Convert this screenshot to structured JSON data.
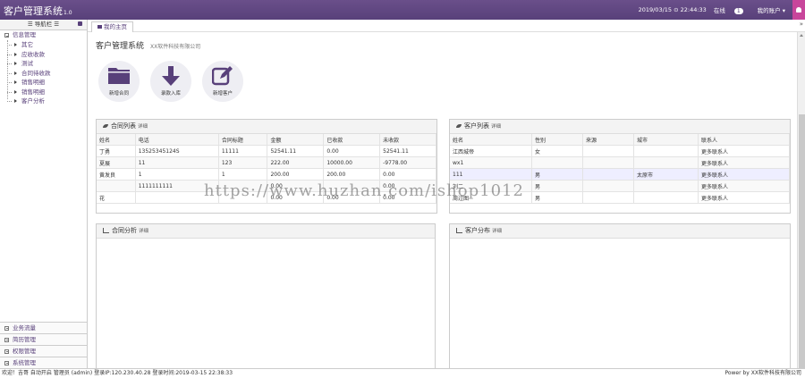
{
  "header": {
    "brand": "客户管理系统",
    "version": "1.0",
    "datetime": "2019/03/15 ⊙ 22:44:33",
    "online_label": "在线",
    "online_count": "1",
    "user_menu": "我的账户 ▾"
  },
  "sidebar": {
    "title": "☰ 导航栏 ☰",
    "group_main": "信息管理",
    "items": [
      "其它",
      "应收收款",
      "测试",
      "合同待收款",
      "销售明细",
      "销售明细",
      "客户分析"
    ],
    "bottom_groups": [
      "业务流量",
      "简历管理",
      "权限管理",
      "系统管理"
    ]
  },
  "tabs": {
    "home": "我的主页",
    "chevron": "»"
  },
  "page": {
    "title": "客户管理系统",
    "subtitle": "XX软件科技有限公司",
    "quick_buttons": [
      {
        "label": "新增合同",
        "icon": "folder-icon"
      },
      {
        "label": "录款入库",
        "icon": "arrow-down-icon"
      },
      {
        "label": "新增客户",
        "icon": "edit-icon"
      }
    ]
  },
  "contract_panel": {
    "title": "合同列表",
    "more": "详细",
    "columns": [
      "姓名",
      "电话",
      "合同标题",
      "金额",
      "已收款",
      "未收款"
    ],
    "rows": [
      [
        "丁勇",
        "13525345124S",
        "11111",
        "52541.11",
        "0.00",
        "52541.11"
      ],
      [
        "夏展",
        "11",
        "123",
        "222.00",
        "10000.00",
        "-9778.00"
      ],
      [
        "黄发良",
        "1",
        "1",
        "200.00",
        "200.00",
        "0.00"
      ],
      [
        "",
        "1111111111",
        "",
        "0.00",
        "",
        "0.00"
      ],
      [
        "花",
        "",
        "",
        "0.00",
        "0.00",
        "0.00"
      ]
    ]
  },
  "customer_panel": {
    "title": "客户列表",
    "more": "详细",
    "columns": [
      "姓名",
      "性别",
      "来源",
      "城市",
      "联系人"
    ],
    "rows": [
      [
        "江西城帝",
        "女",
        "",
        "",
        "更多联系人"
      ],
      [
        "wx1",
        "",
        "",
        "",
        "更多联系人"
      ],
      [
        "111",
        "男",
        "",
        "太原市",
        "更多联系人"
      ],
      [
        "刘二",
        "男",
        "",
        "",
        "更多联系人"
      ],
      [
        "周过图",
        "男",
        "",
        "",
        "更多联系人"
      ]
    ]
  },
  "contract_analysis": {
    "title": "合同分析",
    "more": "详细"
  },
  "customer_distribution": {
    "title": "客户分布",
    "more": "详细"
  },
  "watermark": "https://www.huzhan.com/ishop1012",
  "footer": {
    "left": "欢迎！吉哥 自动开启 管理员 (admin) 登录IP:120.230.40.28 登录时间:2019-03-15 22:38:33",
    "right": "Power by XX软件科技有限公司"
  }
}
